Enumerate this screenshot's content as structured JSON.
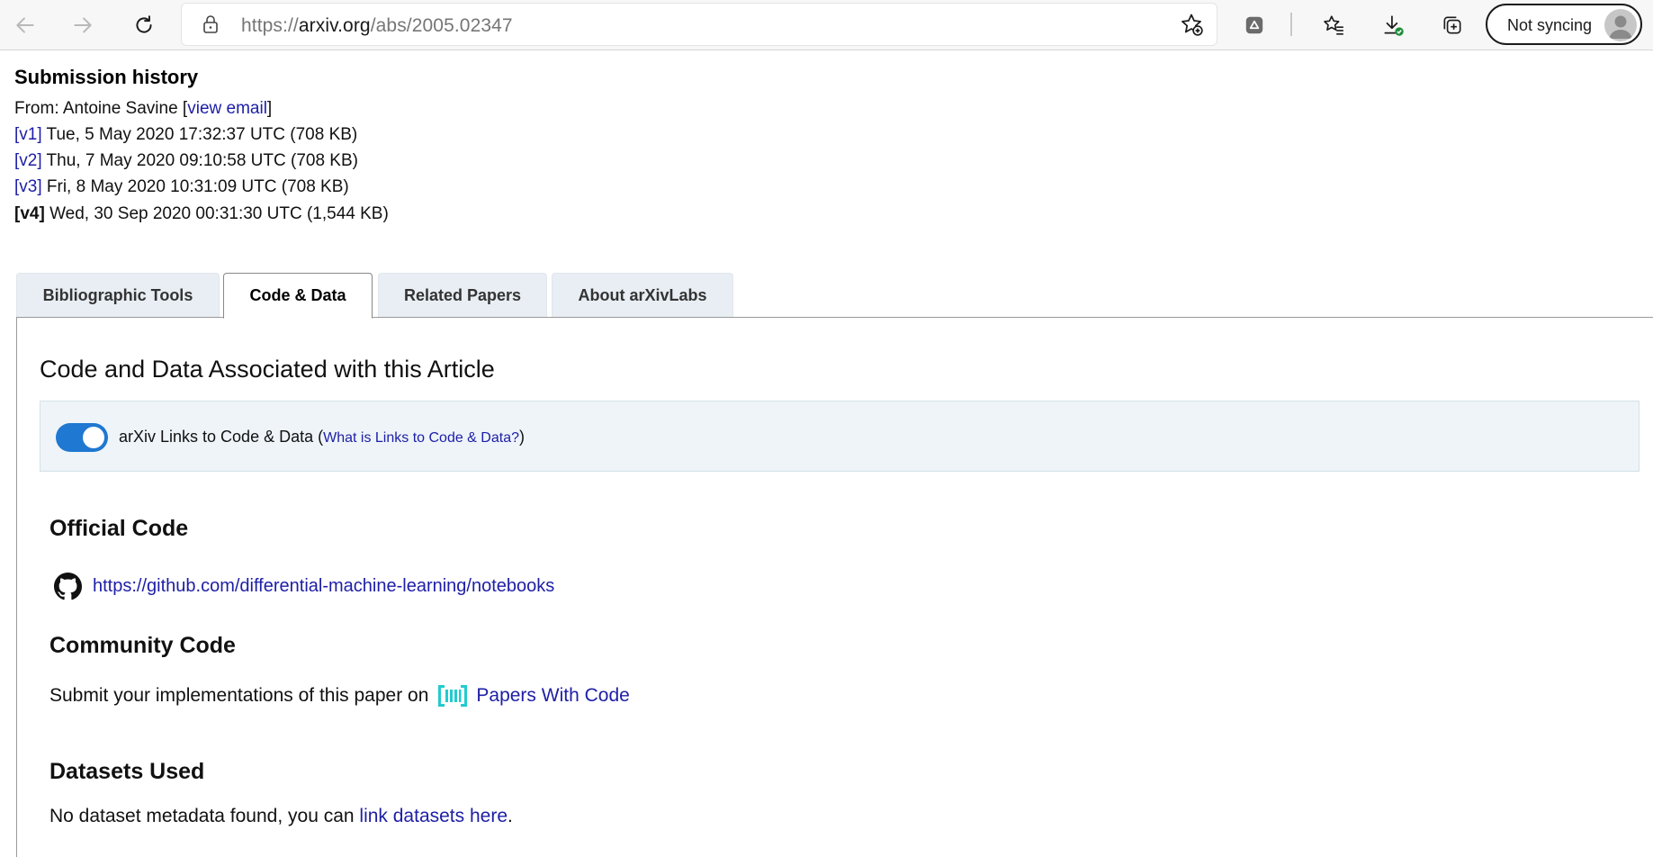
{
  "browser": {
    "url_prefix": "https://",
    "url_host": "arxiv.org",
    "url_path": "/abs/2005.02347",
    "sync_label": "Not syncing",
    "icons": [
      "back-icon",
      "forward-icon",
      "refresh-icon",
      "lock-icon",
      "add-favorite-icon",
      "extension-icon",
      "favorites-icon",
      "downloads-icon",
      "collections-icon",
      "profile-avatar"
    ]
  },
  "history": {
    "title": "Submission history",
    "from_prefix": "From: Antoine Savine [",
    "from_link": "view email",
    "from_suffix": "]",
    "versions": [
      {
        "label": "[v1]",
        "text": " Tue, 5 May 2020 17:32:37 UTC (708 KB)"
      },
      {
        "label": "[v2]",
        "text": " Thu, 7 May 2020 09:10:58 UTC (708 KB)"
      },
      {
        "label": "[v3]",
        "text": " Fri, 8 May 2020 10:31:09 UTC (708 KB)"
      },
      {
        "label": "[v4]",
        "text": " Wed, 30 Sep 2020 00:31:30 UTC (1,544 KB)"
      }
    ]
  },
  "tabs": [
    {
      "label": "Bibliographic Tools"
    },
    {
      "label": "Code & Data"
    },
    {
      "label": "Related Papers"
    },
    {
      "label": "About arXivLabs"
    }
  ],
  "code_data": {
    "title": "Code and Data Associated with this Article",
    "toggle_label": "arXiv Links to Code & Data (",
    "toggle_link": "What is Links to Code & Data?",
    "toggle_suffix": ")",
    "official_heading": "Official Code",
    "official_link": "https://github.com/differential-machine-learning/notebooks",
    "community_heading": "Community Code",
    "community_text": "Submit your implementations of this paper on",
    "community_link": "Papers With Code",
    "datasets_heading": "Datasets Used",
    "datasets_text": "No dataset metadata found, you can ",
    "datasets_link": "link datasets here",
    "datasets_suffix": "."
  },
  "colors": {
    "link": "#1d1ea6",
    "toggle_on": "#1f78d1",
    "pwc_brand": "#21cbce"
  }
}
